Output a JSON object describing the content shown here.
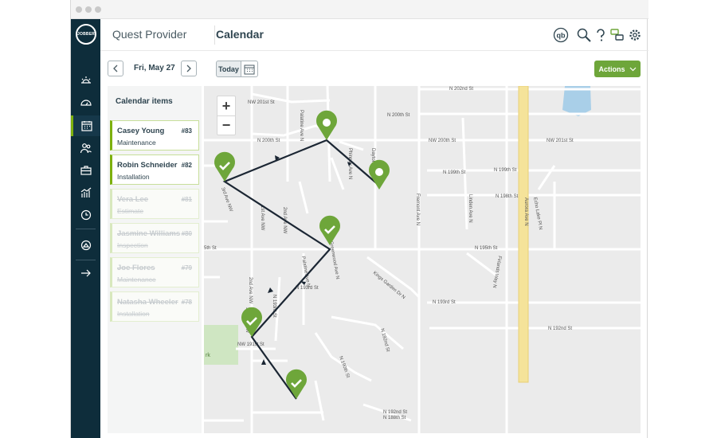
{
  "header": {
    "company": "Quest Provider",
    "page_title": "Calendar"
  },
  "toolbar": {
    "date": "Fri, May 27",
    "today_label": "Today",
    "actions_label": "Actions"
  },
  "panel": {
    "title": "Calendar items",
    "items": [
      {
        "name": "Casey Young",
        "num": "#83",
        "type": "Maintenance",
        "done": false
      },
      {
        "name": "Robin Schneider",
        "num": "#82",
        "type": "Installation",
        "done": false
      },
      {
        "name": "Vera Lee",
        "num": "#81",
        "type": "Estimate",
        "done": true
      },
      {
        "name": "Jasmine Williams",
        "num": "#80",
        "type": "Inspection",
        "done": true
      },
      {
        "name": "Joe Flores",
        "num": "#79",
        "type": "Maintenance",
        "done": true
      },
      {
        "name": "Natasha Wheeler",
        "num": "#78",
        "type": "Installation",
        "done": true
      }
    ]
  },
  "map": {
    "zoom_in": "+",
    "zoom_out": "−",
    "park_label": "rk",
    "streets": [
      "N 202nd St",
      "NW 201st St",
      "N 200th St",
      "NW 200th St",
      "N 200th St",
      "NW 201st St",
      "N 199th St",
      "N 199th St",
      "N 198th St",
      "N 195th St",
      "5th St",
      "N 193rd St",
      "N 192nd St",
      "NW 191st St",
      "N 188th St",
      "3rd Ave NW",
      "1st Ave NW",
      "2nd Ave NW",
      "3rd Ave NW",
      "2nd Ave NW",
      "Palatine Ave N",
      "Phinney Ave N",
      "Dayton",
      "Fremont Ave N",
      "Linden Ave N",
      "Aurora Ave N",
      "Echo Lake Pl N",
      "Firlands Way N",
      "Kings Garden Dr N",
      "N 192nd St",
      "N 190th St",
      "Palatine Ave N",
      "Greenwood Ave N",
      "N 193rd St"
    ]
  },
  "colors": {
    "sidebar": "#0e2d3b",
    "accent": "#7db00e",
    "actions": "#6ea63a",
    "pin": "#6ea63a",
    "route": "#1b2633",
    "highway": "#f5e39a",
    "water": "#a9cfe8",
    "park": "#cfe6c2"
  }
}
